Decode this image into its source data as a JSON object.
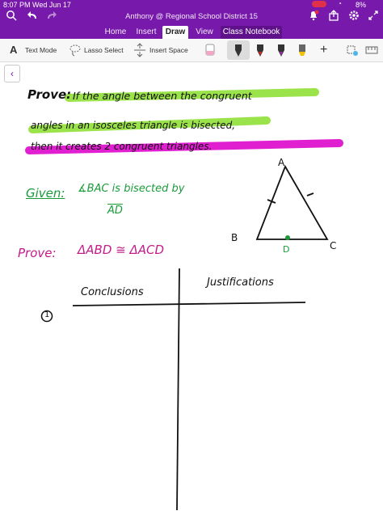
{
  "status_bar": {
    "time": "8:07 PM",
    "date": "Wed Jun 17",
    "battery": "8%"
  },
  "app": {
    "document_title": "Anthony @ Regional School District 15"
  },
  "tabs": [
    {
      "label": "Home",
      "active": false
    },
    {
      "label": "Insert",
      "active": false
    },
    {
      "label": "Draw",
      "active": true
    },
    {
      "label": "View",
      "active": false
    },
    {
      "label": "Class Notebook",
      "active": false
    }
  ],
  "ribbon": {
    "text_mode": "Text Mode",
    "lasso_select": "Lasso Select",
    "insert_space": "Insert Space",
    "pen_colors": [
      "#222222",
      "#cc2222",
      "#7a1fa2",
      "#e0e000",
      "#ff9800"
    ]
  },
  "notes": {
    "prove_label": "Prove:",
    "prove_line1": "If the angle between the congruent",
    "prove_line2": "angles in an isosceles triangle is bisected,",
    "prove_line3": "then it creates 2 congruent triangles.",
    "given_label": "Given:",
    "given_text": "∡BAC is bisected by",
    "given_segment": "AD",
    "prove2_label": "Prove:",
    "prove2_text": "ΔABD ≅ ΔACD",
    "col_conclusions": "Conclusions",
    "col_justifications": "Justifications",
    "row_number": "1",
    "vertex_a": "A",
    "vertex_b": "B",
    "vertex_c": "C",
    "vertex_d": "D"
  },
  "colors": {
    "brand": "#7719aa",
    "highlight_green": "#9be34a",
    "highlight_magenta": "#e020d0",
    "ink_green": "#1a9b3a",
    "ink_purple": "#c41a8a",
    "ink_black": "#111111"
  }
}
